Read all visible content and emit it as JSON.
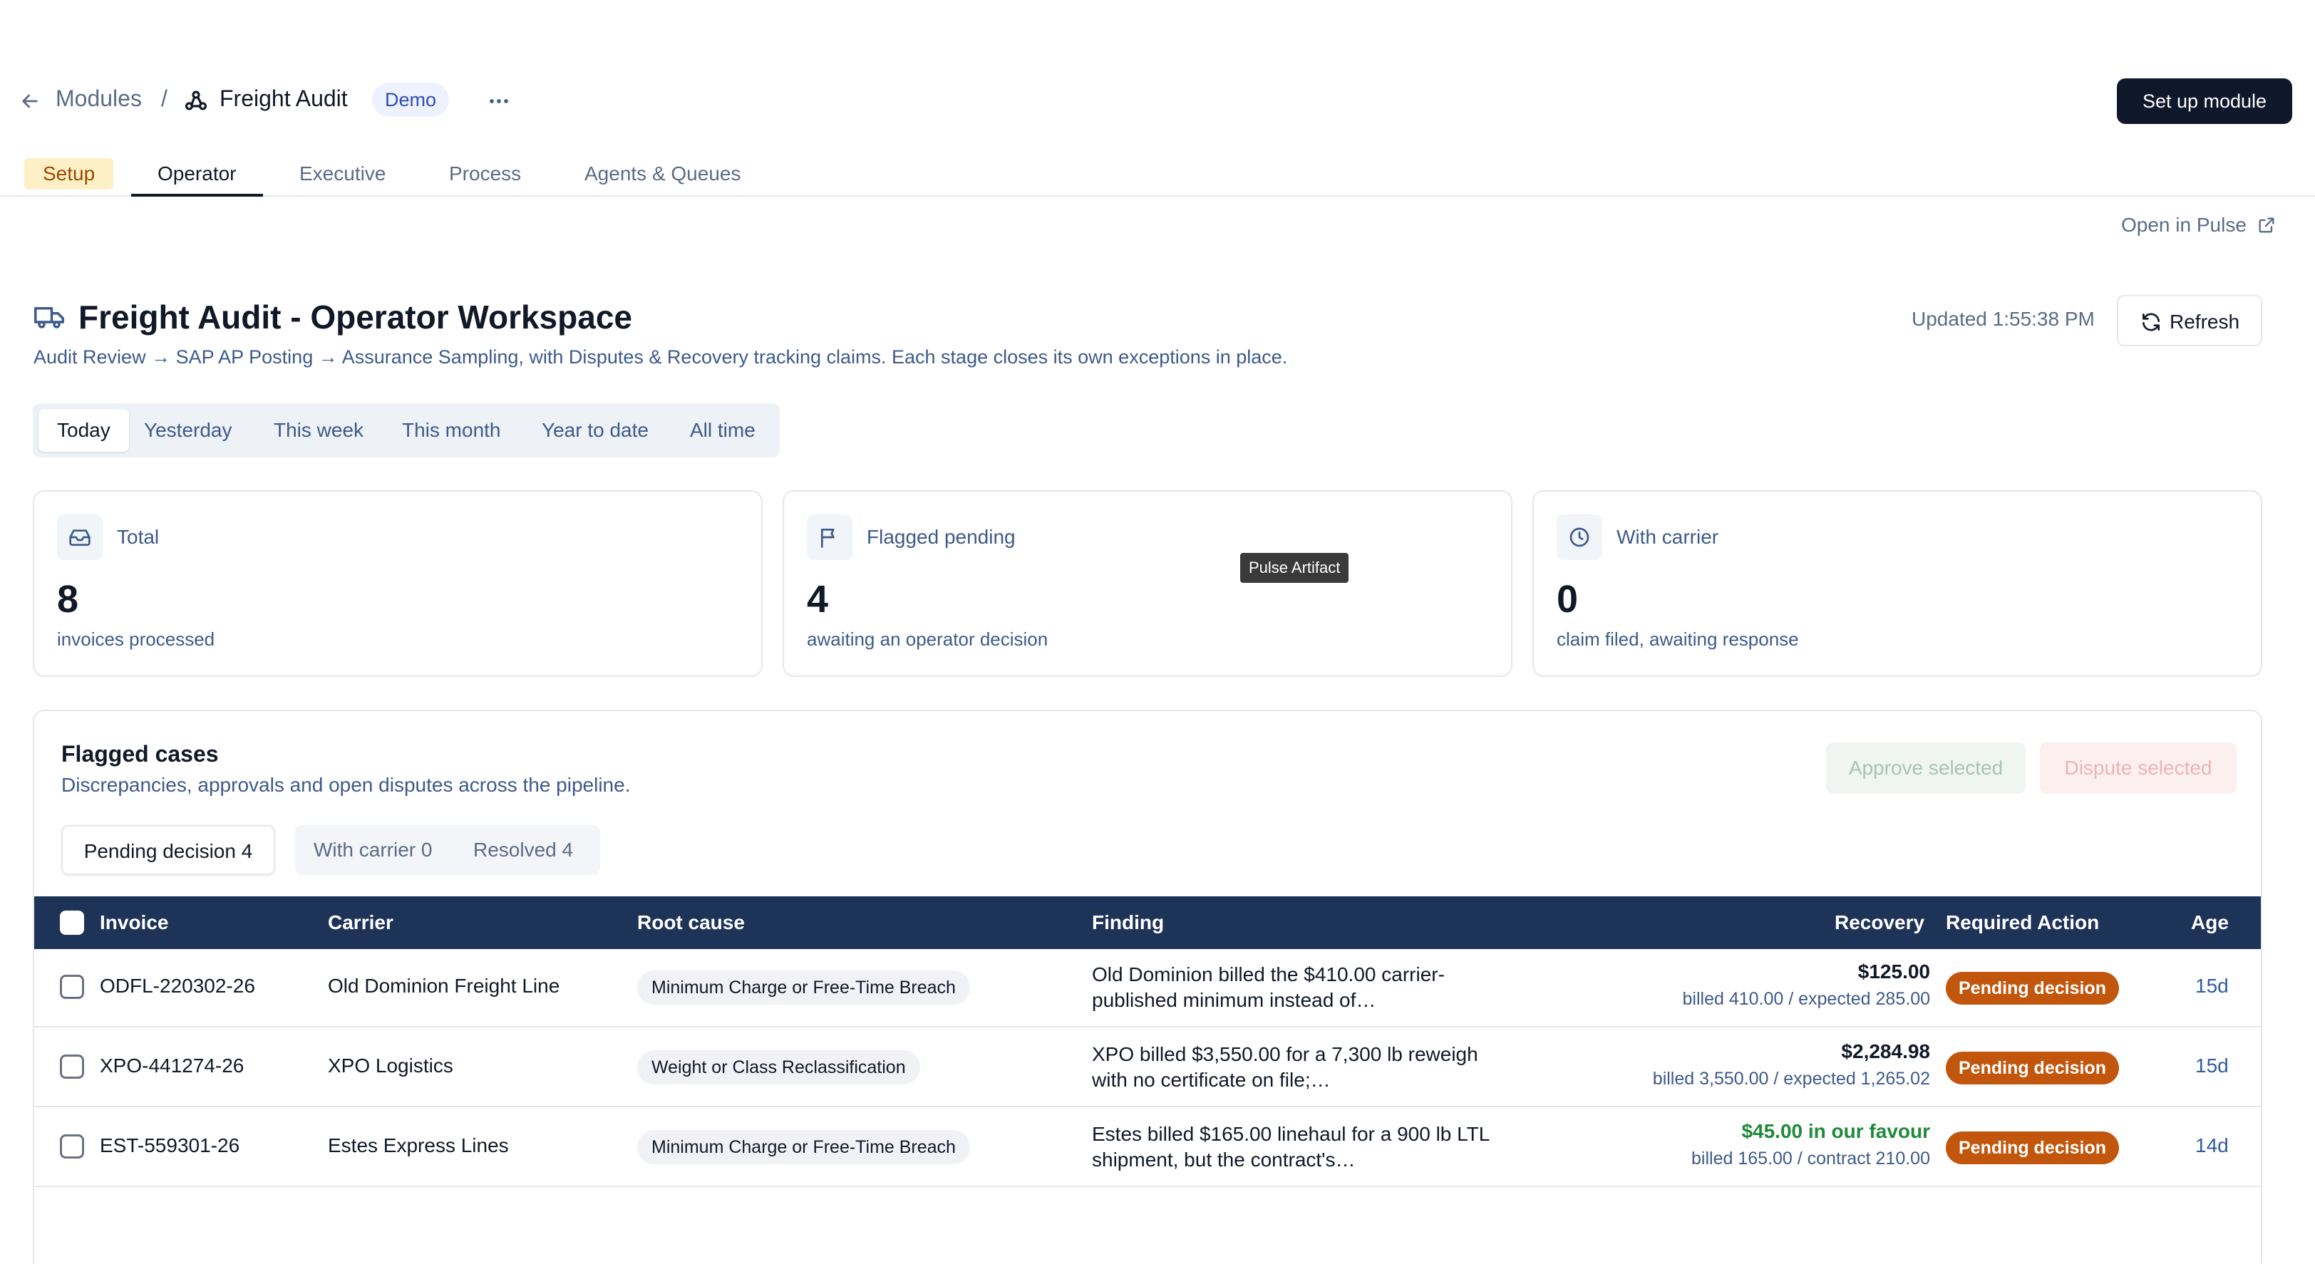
{
  "header": {
    "back_label": "←",
    "breadcrumb_root": "Modules",
    "breadcrumb_sep": "/",
    "module_title": "Freight Audit",
    "badge": "Demo",
    "more": "···",
    "setup_button": "Set up module"
  },
  "tabs": [
    {
      "label": "Setup"
    },
    {
      "label": "Operator"
    },
    {
      "label": "Executive"
    },
    {
      "label": "Process"
    },
    {
      "label": "Agents & Queues"
    }
  ],
  "open_in_pulse": "Open in Pulse",
  "workspace": {
    "title": "Freight Audit - Operator Workspace",
    "subtitle": "Audit Review → SAP AP Posting → Assurance Sampling, with Disputes & Recovery tracking claims. Each stage closes its own exceptions in place.",
    "updated": "Updated 1:55:38 PM",
    "refresh": "Refresh"
  },
  "periods": [
    {
      "label": "Today"
    },
    {
      "label": "Yesterday"
    },
    {
      "label": "This week"
    },
    {
      "label": "This month"
    },
    {
      "label": "Year to date"
    },
    {
      "label": "All time"
    }
  ],
  "stats": [
    {
      "label": "Total",
      "value": "8",
      "desc": "invoices processed",
      "icon": "inbox-icon"
    },
    {
      "label": "Flagged pending",
      "value": "4",
      "desc": "awaiting an operator decision",
      "icon": "flag-icon"
    },
    {
      "label": "With carrier",
      "value": "0",
      "desc": "claim filed, awaiting response",
      "icon": "clock-icon"
    }
  ],
  "tooltip": "Pulse Artifact",
  "flagged": {
    "title": "Flagged cases",
    "subtitle": "Discrepancies, approvals and open disputes across the pipeline.",
    "approve": "Approve selected",
    "dispute": "Dispute selected",
    "subtabs": [
      {
        "label": "Pending decision 4"
      },
      {
        "label": "With carrier 0"
      },
      {
        "label": "Resolved 4"
      }
    ],
    "columns": {
      "invoice": "Invoice",
      "carrier": "Carrier",
      "root_cause": "Root cause",
      "finding": "Finding",
      "recovery": "Recovery",
      "action": "Required Action",
      "age": "Age"
    },
    "rows": [
      {
        "invoice": "ODFL-220302-26",
        "carrier": "Old Dominion Freight Line",
        "root_cause": "Minimum Charge or Free-Time Breach",
        "finding": "Old Dominion billed the $410.00 carrier-published minimum instead of…",
        "recovery": "$125.00",
        "recovery_sub": "billed 410.00 / expected 285.00",
        "status": "Pending decision",
        "age": "15d"
      },
      {
        "invoice": "XPO-441274-26",
        "carrier": "XPO Logistics",
        "root_cause": "Weight or Class Reclassification",
        "finding": "XPO billed $3,550.00 for a 7,300 lb reweigh with no certificate on file;…",
        "recovery": "$2,284.98",
        "recovery_sub": "billed 3,550.00 / expected 1,265.02",
        "status": "Pending decision",
        "age": "15d"
      },
      {
        "invoice": "EST-559301-26",
        "carrier": "Estes Express Lines",
        "root_cause": "Minimum Charge or Free-Time Breach",
        "finding": "Estes billed $165.00 linehaul for a 900 lb LTL shipment, but the contract's…",
        "recovery": "$45.00 in our favour",
        "recovery_sub": "billed 165.00 / contract 210.00",
        "status": "Pending decision",
        "age": "14d"
      }
    ]
  },
  "colors": {
    "table_header": "#1e3358",
    "status_pending": "#c2560c",
    "favour": "#1f8a3a",
    "setup_tab_bg": "#fdf0c7"
  }
}
